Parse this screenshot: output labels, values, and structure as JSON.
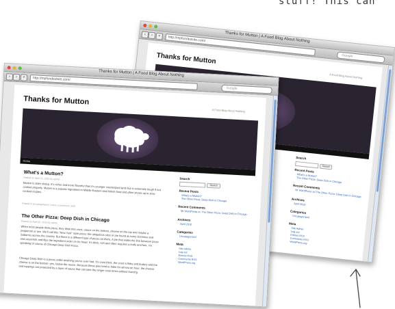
{
  "handwritten_note": "stuff! This can",
  "back_window": {
    "window_title": "Thanks for Mutton | A Food Blog About Nothing",
    "url": "http://mpfundedsite.com/",
    "search_placeholder": "Google",
    "site_title": "Thanks for Mutton",
    "tagline": "A Food Blog About Nothing",
    "sidebar": {
      "search_heading": "Search",
      "search_button": "Search",
      "recent_posts_heading": "Recent Posts",
      "recent_posts": [
        "What's a Mutton?",
        "The Other Pizza: Deep Dish in Chicago"
      ],
      "recent_comments_heading": "Recent Comments",
      "recent_comments": [
        "Mr WordPress on The Other Pizza: Deep Dish in Chicago"
      ],
      "archives_heading": "Archives",
      "archives": [
        "April 2010"
      ],
      "categories_heading": "Categories",
      "categories": [
        "Uncategorized"
      ],
      "meta_heading": "Meta",
      "meta": [
        "Site Admin",
        "Log out",
        "Entries RSS",
        "Comments RSS",
        "WordPress.org"
      ]
    }
  },
  "front_window": {
    "window_title": "Thanks for Mutton | A Food Blog About Nothing",
    "url": "http://mpfundedsite.com/",
    "search_placeholder": "Google",
    "site_title": "Thanks for Mutton",
    "tagline": "A Food Blog About Nothing",
    "menu": [
      "Home"
    ],
    "posts": [
      {
        "title": "What's a Mutton?",
        "meta": "Posted on April 22, 2010 by admin",
        "body": "Mutton is older sheep. It's richer and more flavorful than it's younger counterpart lamb but is extremely tough if not cooked properly. Mutton is a popular ingredient in Middle Eastern and British food and often shows up in slow cooked recipes.",
        "footer": "Posted in Uncategorized | Leave a comment | Edit"
      },
      {
        "title": "The Other Pizza: Deep Dish in Chicago",
        "meta": "Posted on April 22, 2010 by admin",
        "body": "When most people think pizza, they think thin crust, sauce on the bottom, cheese on the top and maybe a pepperoni or two. We'll call this \"New York\" style pizza: the ubiquitous slice or pie found at every Dominos and Sabarros across the country. But there is a different type of pizza out there. A pie that walks the line between pizza and casserole and flips the ingredient order on it's head. It's thick, rich and often requires a knife and fork. I'm speaking of course of Chicago Deep Dish Pizza.",
        "body2": "Chicago Deep Dish is a pizza unlike anything you've ever had. It's crust thick, the crust is flaky and buttery and the cheese is on the bottom--yes, below the sauce. Because these pies tend to bake for almost an hour, the cheese and toppings are protected by a layer of sauce that can take the longer cook times without burning."
      }
    ],
    "sidebar": {
      "search_heading": "Search",
      "search_button": "Search",
      "recent_posts_heading": "Recent Posts",
      "recent_posts": [
        "What's a Mutton?",
        "The Other Pizza: Deep Dish in Chicago"
      ],
      "recent_comments_heading": "Recent Comments",
      "recent_comments": [
        "Mr WordPress on The Other Pizza: Deep Dish in Chicago"
      ],
      "archives_heading": "Archives",
      "archives": [
        "April 2010"
      ],
      "categories_heading": "Categories",
      "categories": [
        "Uncategorized"
      ],
      "meta_heading": "Meta",
      "meta": [
        "Site Admin",
        "Log out",
        "Entries RSS",
        "Comments RSS",
        "WordPress.org"
      ]
    }
  },
  "colors": {
    "header_bg": "#2a2330",
    "link": "#2a62b8",
    "menu_bg": "#111111"
  }
}
